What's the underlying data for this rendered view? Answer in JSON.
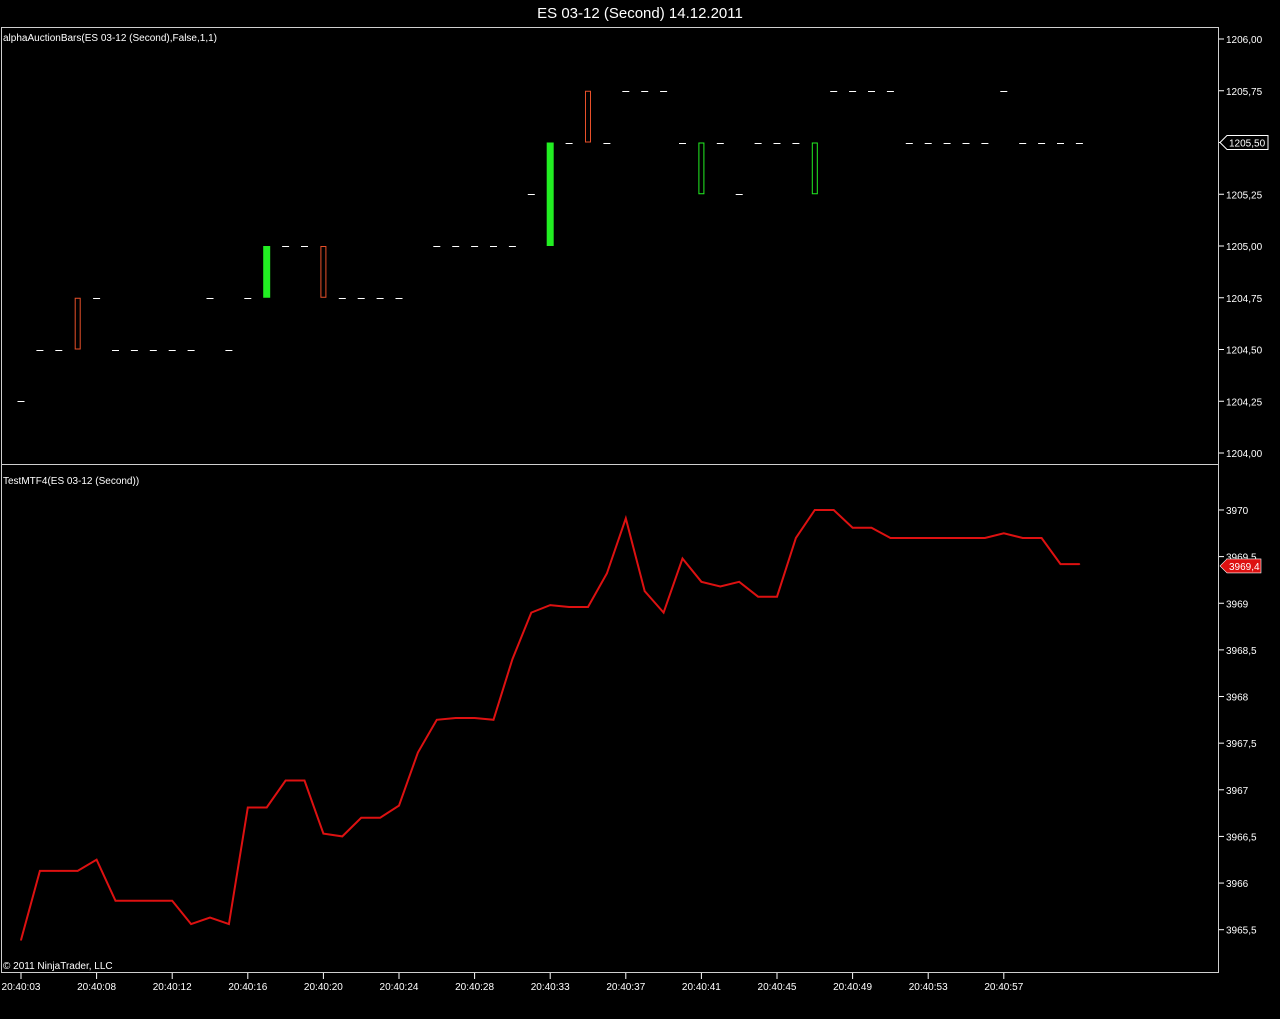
{
  "window": {
    "title": "ES 03-12 (Second)  14.12.2011"
  },
  "copyright": "© 2011 NinjaTrader, LLC",
  "colors": {
    "background": "#000000",
    "axis": "#ffffff",
    "frame": "#cfcfcf",
    "up_bar": "#22ee22",
    "down_bar": "#e8502a",
    "line": "#dd1111",
    "price_tag_bg": "#dd1111"
  },
  "chart_data": [
    {
      "type": "bar",
      "title": "alphaAuctionBars(ES 03-12 (Second),False,1,1)",
      "ylim": [
        1204.0,
        1206.0
      ],
      "y_ticks": [
        "1206,00",
        "1205,75",
        "1205,50",
        "1205,25",
        "1205,00",
        "1204,75",
        "1204,50",
        "1204,25",
        "1204,00"
      ],
      "last_price_label": "1205,50",
      "x_index_range": [
        0,
        56
      ],
      "bars": [
        {
          "i": 0,
          "kind": "dash",
          "value": 1204.25
        },
        {
          "i": 1,
          "kind": "dash",
          "value": 1204.5
        },
        {
          "i": 2,
          "kind": "dash",
          "value": 1204.5
        },
        {
          "i": 3,
          "kind": "box",
          "style": "hollow-red",
          "low": 1204.5,
          "high": 1204.75
        },
        {
          "i": 4,
          "kind": "dash",
          "value": 1204.75
        },
        {
          "i": 5,
          "kind": "dash",
          "value": 1204.5
        },
        {
          "i": 6,
          "kind": "dash",
          "value": 1204.5
        },
        {
          "i": 7,
          "kind": "dash",
          "value": 1204.5
        },
        {
          "i": 8,
          "kind": "dash",
          "value": 1204.5
        },
        {
          "i": 9,
          "kind": "dash",
          "value": 1204.5
        },
        {
          "i": 10,
          "kind": "dash",
          "value": 1204.75
        },
        {
          "i": 11,
          "kind": "dash",
          "value": 1204.5
        },
        {
          "i": 12,
          "kind": "dash",
          "value": 1204.75
        },
        {
          "i": 13,
          "kind": "box",
          "style": "solid-green",
          "low": 1204.75,
          "high": 1205.0
        },
        {
          "i": 14,
          "kind": "dash",
          "value": 1205.0
        },
        {
          "i": 15,
          "kind": "dash",
          "value": 1205.0
        },
        {
          "i": 16,
          "kind": "box",
          "style": "hollow-red",
          "low": 1204.75,
          "high": 1205.0
        },
        {
          "i": 17,
          "kind": "dash",
          "value": 1204.75
        },
        {
          "i": 18,
          "kind": "dash",
          "value": 1204.75
        },
        {
          "i": 19,
          "kind": "dash",
          "value": 1204.75
        },
        {
          "i": 20,
          "kind": "dash",
          "value": 1204.75
        },
        {
          "i": 22,
          "kind": "dash",
          "value": 1205.0
        },
        {
          "i": 23,
          "kind": "dash",
          "value": 1205.0
        },
        {
          "i": 24,
          "kind": "dash",
          "value": 1205.0
        },
        {
          "i": 25,
          "kind": "dash",
          "value": 1205.0
        },
        {
          "i": 26,
          "kind": "dash",
          "value": 1205.0
        },
        {
          "i": 27,
          "kind": "dash",
          "value": 1205.25
        },
        {
          "i": 28,
          "kind": "box",
          "style": "solid-green",
          "low": 1205.0,
          "high": 1205.5
        },
        {
          "i": 29,
          "kind": "dash",
          "value": 1205.5
        },
        {
          "i": 30,
          "kind": "box",
          "style": "hollow-red",
          "low": 1205.5,
          "high": 1205.75
        },
        {
          "i": 31,
          "kind": "dash",
          "value": 1205.5
        },
        {
          "i": 32,
          "kind": "dash",
          "value": 1205.75
        },
        {
          "i": 33,
          "kind": "dash",
          "value": 1205.75
        },
        {
          "i": 34,
          "kind": "dash",
          "value": 1205.75
        },
        {
          "i": 35,
          "kind": "dash",
          "value": 1205.5
        },
        {
          "i": 36,
          "kind": "box",
          "style": "hollow-green",
          "low": 1205.25,
          "high": 1205.5
        },
        {
          "i": 37,
          "kind": "dash",
          "value": 1205.5
        },
        {
          "i": 38,
          "kind": "dash",
          "value": 1205.25
        },
        {
          "i": 39,
          "kind": "dash",
          "value": 1205.5
        },
        {
          "i": 40,
          "kind": "dash",
          "value": 1205.5
        },
        {
          "i": 41,
          "kind": "dash",
          "value": 1205.5
        },
        {
          "i": 42,
          "kind": "box",
          "style": "hollow-green",
          "low": 1205.25,
          "high": 1205.5
        },
        {
          "i": 43,
          "kind": "dash",
          "value": 1205.75
        },
        {
          "i": 44,
          "kind": "dash",
          "value": 1205.75
        },
        {
          "i": 45,
          "kind": "dash",
          "value": 1205.75
        },
        {
          "i": 46,
          "kind": "dash",
          "value": 1205.75
        },
        {
          "i": 47,
          "kind": "dash",
          "value": 1205.5
        },
        {
          "i": 48,
          "kind": "dash",
          "value": 1205.5
        },
        {
          "i": 49,
          "kind": "dash",
          "value": 1205.5
        },
        {
          "i": 50,
          "kind": "dash",
          "value": 1205.5
        },
        {
          "i": 51,
          "kind": "dash",
          "value": 1205.5
        },
        {
          "i": 52,
          "kind": "dash",
          "value": 1205.75
        },
        {
          "i": 53,
          "kind": "dash",
          "value": 1205.5
        },
        {
          "i": 54,
          "kind": "dash",
          "value": 1205.5
        },
        {
          "i": 55,
          "kind": "dash",
          "value": 1205.5
        },
        {
          "i": 56,
          "kind": "dash",
          "value": 1205.5
        }
      ]
    },
    {
      "type": "line",
      "title": "TestMTF4(ES 03-12 (Second))",
      "ylim": [
        3965.1,
        3970.3
      ],
      "y_ticks": [
        {
          "value": 3970.0,
          "label": "3970"
        },
        {
          "value": 3969.5,
          "label": "3969,5"
        },
        {
          "value": 3969.0,
          "label": "3969"
        },
        {
          "value": 3968.5,
          "label": "3968,5"
        },
        {
          "value": 3968.0,
          "label": "3968"
        },
        {
          "value": 3967.5,
          "label": "3967,5"
        },
        {
          "value": 3967.0,
          "label": "3967"
        },
        {
          "value": 3966.5,
          "label": "3966,5"
        },
        {
          "value": 3966.0,
          "label": "3966"
        },
        {
          "value": 3965.5,
          "label": "3965,5"
        }
      ],
      "last_value_label": "3969,4",
      "x_index_range": [
        0,
        56
      ],
      "x_ticks": [
        {
          "i": 0,
          "label": "20:40:03"
        },
        {
          "i": 4,
          "label": "20:40:08"
        },
        {
          "i": 8,
          "label": "20:40:12"
        },
        {
          "i": 12,
          "label": "20:40:16"
        },
        {
          "i": 16,
          "label": "20:40:20"
        },
        {
          "i": 20,
          "label": "20:40:24"
        },
        {
          "i": 24,
          "label": "20:40:28"
        },
        {
          "i": 28,
          "label": "20:40:33"
        },
        {
          "i": 32,
          "label": "20:40:37"
        },
        {
          "i": 36,
          "label": "20:40:41"
        },
        {
          "i": 40,
          "label": "20:40:45"
        },
        {
          "i": 44,
          "label": "20:40:49"
        },
        {
          "i": 48,
          "label": "20:40:53"
        },
        {
          "i": 52,
          "label": "20:40:57"
        }
      ],
      "series": [
        {
          "values": [
            3965.39,
            3966.13,
            3966.13,
            3966.13,
            3966.25,
            3965.81,
            3965.81,
            3965.81,
            3965.81,
            3965.56,
            3965.63,
            3965.56,
            3966.81,
            3966.81,
            3967.1,
            3967.1,
            3966.53,
            3966.5,
            3966.7,
            3966.7,
            3966.83,
            3967.4,
            3967.75,
            3967.77,
            3967.77,
            3967.75,
            3968.4,
            3968.9,
            3968.98,
            3968.96,
            3968.96,
            3969.32,
            3969.91,
            3969.13,
            3968.9,
            3969.48,
            3969.23,
            3969.18,
            3969.23,
            3969.07,
            3969.07,
            3969.7,
            3970.0,
            3970.0,
            3969.81,
            3969.81,
            3969.7,
            3969.7,
            3969.7,
            3969.7,
            3969.7,
            3969.7,
            3969.75,
            3969.7,
            3969.7,
            3969.42,
            3969.42
          ]
        }
      ]
    }
  ]
}
